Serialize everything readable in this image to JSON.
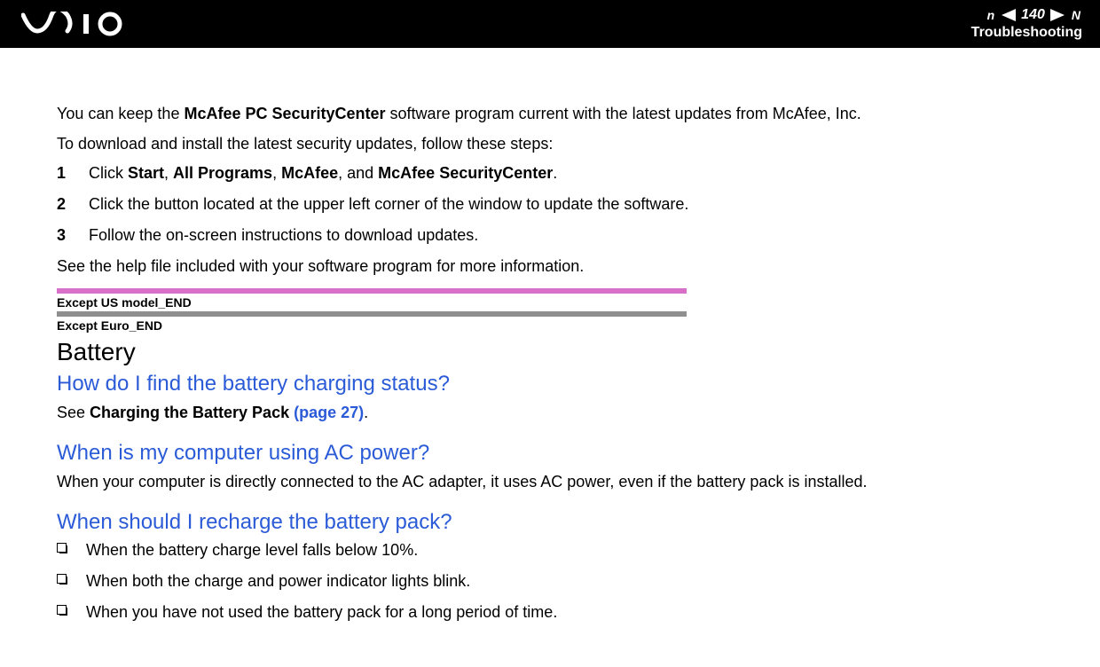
{
  "header": {
    "page_number": "140",
    "nav_prev_letter": "n",
    "nav_next_letter": "N",
    "section": "Troubleshooting"
  },
  "intro": {
    "p1_prefix": "You can keep the ",
    "p1_bold": "McAfee PC SecurityCenter",
    "p1_suffix": " software program current with the latest updates from McAfee, Inc.",
    "p2": "To download and install the latest security updates, follow these steps:"
  },
  "steps": {
    "s1_num": "1",
    "s1_a": "Click ",
    "s1_b1": "Start",
    "s1_c1": ", ",
    "s1_b2": "All Programs",
    "s1_c2": ", ",
    "s1_b3": "McAfee",
    "s1_c3": ", and ",
    "s1_b4": "McAfee SecurityCenter",
    "s1_c4": ".",
    "s2_num": "2",
    "s2_text": "Click the button located at the upper left corner of the window to update the software.",
    "s3_num": "3",
    "s3_text": "Follow the on-screen instructions to download updates."
  },
  "after_steps": "See the help file included with your software program for more information.",
  "markers": {
    "m1": "Except US model_END",
    "m2": "Except Euro_END"
  },
  "battery": {
    "heading": "Battery",
    "q1": "How do I find the battery charging status?",
    "q1_ans_a": "See ",
    "q1_ans_b": "Charging the Battery Pack ",
    "q1_ans_link": "(page 27)",
    "q1_ans_c": ".",
    "q2": "When is my computer using AC power?",
    "q2_ans": "When your computer is directly connected to the AC adapter, it uses AC power, even if the battery pack is installed.",
    "q3": "When should I recharge the battery pack?",
    "q3_b1": "When the battery charge level falls below 10%.",
    "q3_b2": "When both the charge and power indicator lights blink.",
    "q3_b3": "When you have not used the battery pack for a long period of time."
  }
}
